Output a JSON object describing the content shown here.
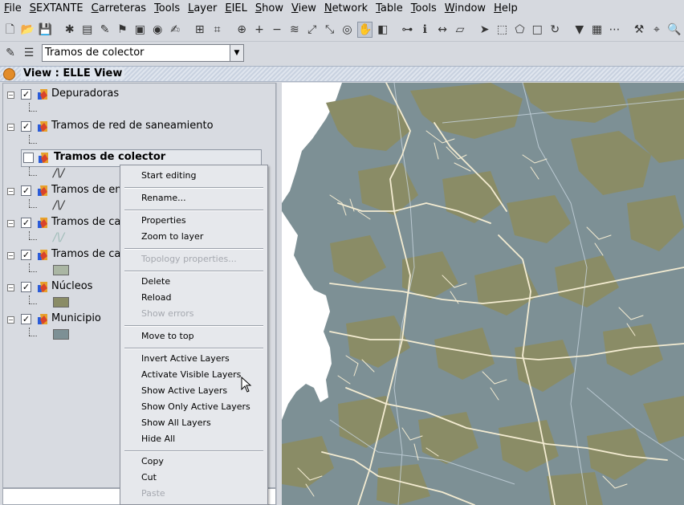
{
  "menubar": {
    "items": [
      {
        "label": "File",
        "mnemonic": "F",
        "rest": "ile"
      },
      {
        "label": "SEXTANTE",
        "mnemonic": "S",
        "rest": "EXTANTE"
      },
      {
        "label": "Carreteras",
        "mnemonic": "C",
        "rest": "arreteras"
      },
      {
        "label": "Tools",
        "mnemonic": "T",
        "rest": "ools"
      },
      {
        "label": "Layer",
        "mnemonic": "L",
        "rest": "ayer"
      },
      {
        "label": "EIEL",
        "mnemonic": "E",
        "rest": "IEL"
      },
      {
        "label": "Show",
        "mnemonic": "S",
        "rest": "how"
      },
      {
        "label": "View",
        "mnemonic": "V",
        "rest": "iew"
      },
      {
        "label": "Network",
        "mnemonic": "N",
        "rest": "etwork"
      },
      {
        "label": "Table",
        "mnemonic": "T",
        "rest": "able"
      },
      {
        "label": "Tools",
        "mnemonic": "T",
        "rest": "ools"
      },
      {
        "label": "Window",
        "mnemonic": "W",
        "rest": "indow"
      },
      {
        "label": "Help",
        "mnemonic": "H",
        "rest": "elp"
      }
    ]
  },
  "toolbar": {
    "icons": [
      "new-file-icon",
      "open-file-icon",
      "save-icon",
      "separator",
      "spatial-icon",
      "layer-add-icon",
      "edit-icon",
      "graph-icon",
      "print-icon",
      "record-icon",
      "note-icon",
      "separator",
      "folder-icon",
      "grid-icon",
      "separator",
      "zoom-select-icon",
      "zoom-in-icon",
      "zoom-out-icon",
      "layers-icon",
      "zoom-full-icon",
      "zoom-extent-icon",
      "eye-icon",
      "pan-icon",
      "pan-layer-icon",
      "separator",
      "measure-icon",
      "info-icon",
      "distance-icon",
      "area-icon",
      "separator",
      "select-icon",
      "select-rect-icon",
      "select-poly-icon",
      "select-all-icon",
      "invert-selection-icon",
      "separator",
      "filter-icon",
      "table-icon",
      "graticule-icon",
      "separator",
      "tools-icon",
      "locate-icon",
      "search-icon"
    ]
  },
  "layer_combo": {
    "value": "Tramos de colector"
  },
  "view": {
    "title": "View : ELLE View"
  },
  "toc": {
    "layers": [
      {
        "name": "Depuradoras",
        "checked": true,
        "symbol": "none"
      },
      {
        "name": "Tramos de red de saneamiento",
        "checked": true,
        "symbol": "none"
      },
      {
        "name": "Tramos de colector",
        "checked": false,
        "symbol": "line",
        "active": true
      },
      {
        "name": "Tramos de em",
        "checked": true,
        "symbol": "line"
      },
      {
        "name": "Tramos de ca",
        "checked": true,
        "symbol": "line-light"
      },
      {
        "name": "Tramos de ca",
        "checked": true,
        "symbol": "fill-light"
      },
      {
        "name": "Núcleos",
        "checked": true,
        "symbol": "fill-olive"
      },
      {
        "name": "Municipio",
        "checked": true,
        "symbol": "fill-slate"
      }
    ]
  },
  "context_menu": {
    "items": [
      {
        "label": "Start editing",
        "enabled": true
      },
      {
        "sep": true
      },
      {
        "label": "Rename...",
        "enabled": true
      },
      {
        "sep": true
      },
      {
        "label": "Properties",
        "enabled": true
      },
      {
        "label": "Zoom to layer",
        "enabled": true
      },
      {
        "sep": true
      },
      {
        "label": "Topology properties...",
        "enabled": false
      },
      {
        "sep": true
      },
      {
        "label": "Delete",
        "enabled": true
      },
      {
        "label": "Reload",
        "enabled": true
      },
      {
        "label": "Show errors",
        "enabled": false
      },
      {
        "sep": true
      },
      {
        "label": "Move to top",
        "enabled": true
      },
      {
        "sep": true
      },
      {
        "label": "Invert Active Layers",
        "enabled": true
      },
      {
        "label": "Activate Visible Layers",
        "enabled": true
      },
      {
        "label": "Show Active Layers",
        "enabled": true
      },
      {
        "label": "Show Only Active Layers",
        "enabled": true
      },
      {
        "label": "Show All Layers",
        "enabled": true
      },
      {
        "label": "Hide All",
        "enabled": true
      },
      {
        "sep": true
      },
      {
        "label": "Copy",
        "enabled": true
      },
      {
        "label": "Cut",
        "enabled": true
      },
      {
        "label": "Paste",
        "enabled": false
      }
    ]
  },
  "colors": {
    "map_background": "#7d9095",
    "nucleos_fill": "#8a8c66",
    "roads": "#f4ecd2",
    "boundary": "#c9d6e0",
    "blank": "#ffffff"
  }
}
